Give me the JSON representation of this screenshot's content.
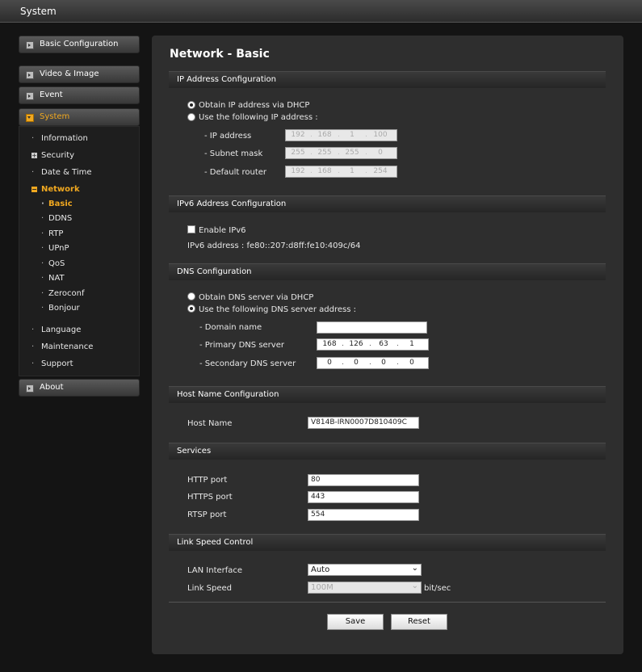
{
  "window": {
    "title": "System"
  },
  "sidebar": {
    "top": [
      {
        "label": "Basic Configuration"
      },
      {
        "label": "Video & Image"
      },
      {
        "label": "Event"
      },
      {
        "label": "System"
      }
    ],
    "system_items": [
      {
        "label": "Information"
      },
      {
        "label": "Security"
      },
      {
        "label": "Date & Time"
      },
      {
        "label": "Network"
      },
      {
        "label": "Language"
      },
      {
        "label": "Maintenance"
      },
      {
        "label": "Support"
      }
    ],
    "network_items": [
      {
        "label": "Basic"
      },
      {
        "label": "DDNS"
      },
      {
        "label": "RTP"
      },
      {
        "label": "UPnP"
      },
      {
        "label": "QoS"
      },
      {
        "label": "NAT"
      },
      {
        "label": "Zeroconf"
      },
      {
        "label": "Bonjour"
      }
    ],
    "about": {
      "label": "About"
    }
  },
  "page": {
    "title": "Network - Basic"
  },
  "ip": {
    "header": "IP Address Configuration",
    "dhcp_label": "Obtain IP address via DHCP",
    "static_label": "Use the following IP address :",
    "ip_label": "- IP address",
    "ip_value": [
      "192",
      "168",
      "1",
      "100"
    ],
    "mask_label": "- Subnet mask",
    "mask_value": [
      "255",
      "255",
      "255",
      "0"
    ],
    "router_label": "- Default router",
    "router_value": [
      "192",
      "168",
      "1",
      "254"
    ]
  },
  "ipv6": {
    "header": "IPv6 Address Configuration",
    "enable_label": "Enable IPv6",
    "address_text": "IPv6 address : fe80::207:d8ff:fe10:409c/64"
  },
  "dns": {
    "header": "DNS Configuration",
    "dhcp_label": "Obtain DNS server via DHCP",
    "static_label": "Use the following DNS server address :",
    "domain_label": "- Domain name",
    "domain_value": "",
    "primary_label": "- Primary DNS server",
    "primary_value": [
      "168",
      "126",
      "63",
      "1"
    ],
    "secondary_label": "- Secondary DNS server",
    "secondary_value": [
      "0",
      "0",
      "0",
      "0"
    ]
  },
  "host": {
    "header": "Host Name Configuration",
    "label": "Host Name",
    "value": "V814B-IRN0007D810409C"
  },
  "services": {
    "header": "Services",
    "http_label": "HTTP port",
    "http_value": "80",
    "https_label": "HTTPS port",
    "https_value": "443",
    "rtsp_label": "RTSP port",
    "rtsp_value": "554"
  },
  "link": {
    "header": "Link Speed Control",
    "lan_label": "LAN Interface",
    "lan_value": "Auto",
    "speed_label": "Link Speed",
    "speed_value": "100M",
    "speed_unit": "bit/sec"
  },
  "buttons": {
    "save": "Save",
    "reset": "Reset"
  },
  "icons": {
    "dropdown": "chevron-down-icon"
  }
}
